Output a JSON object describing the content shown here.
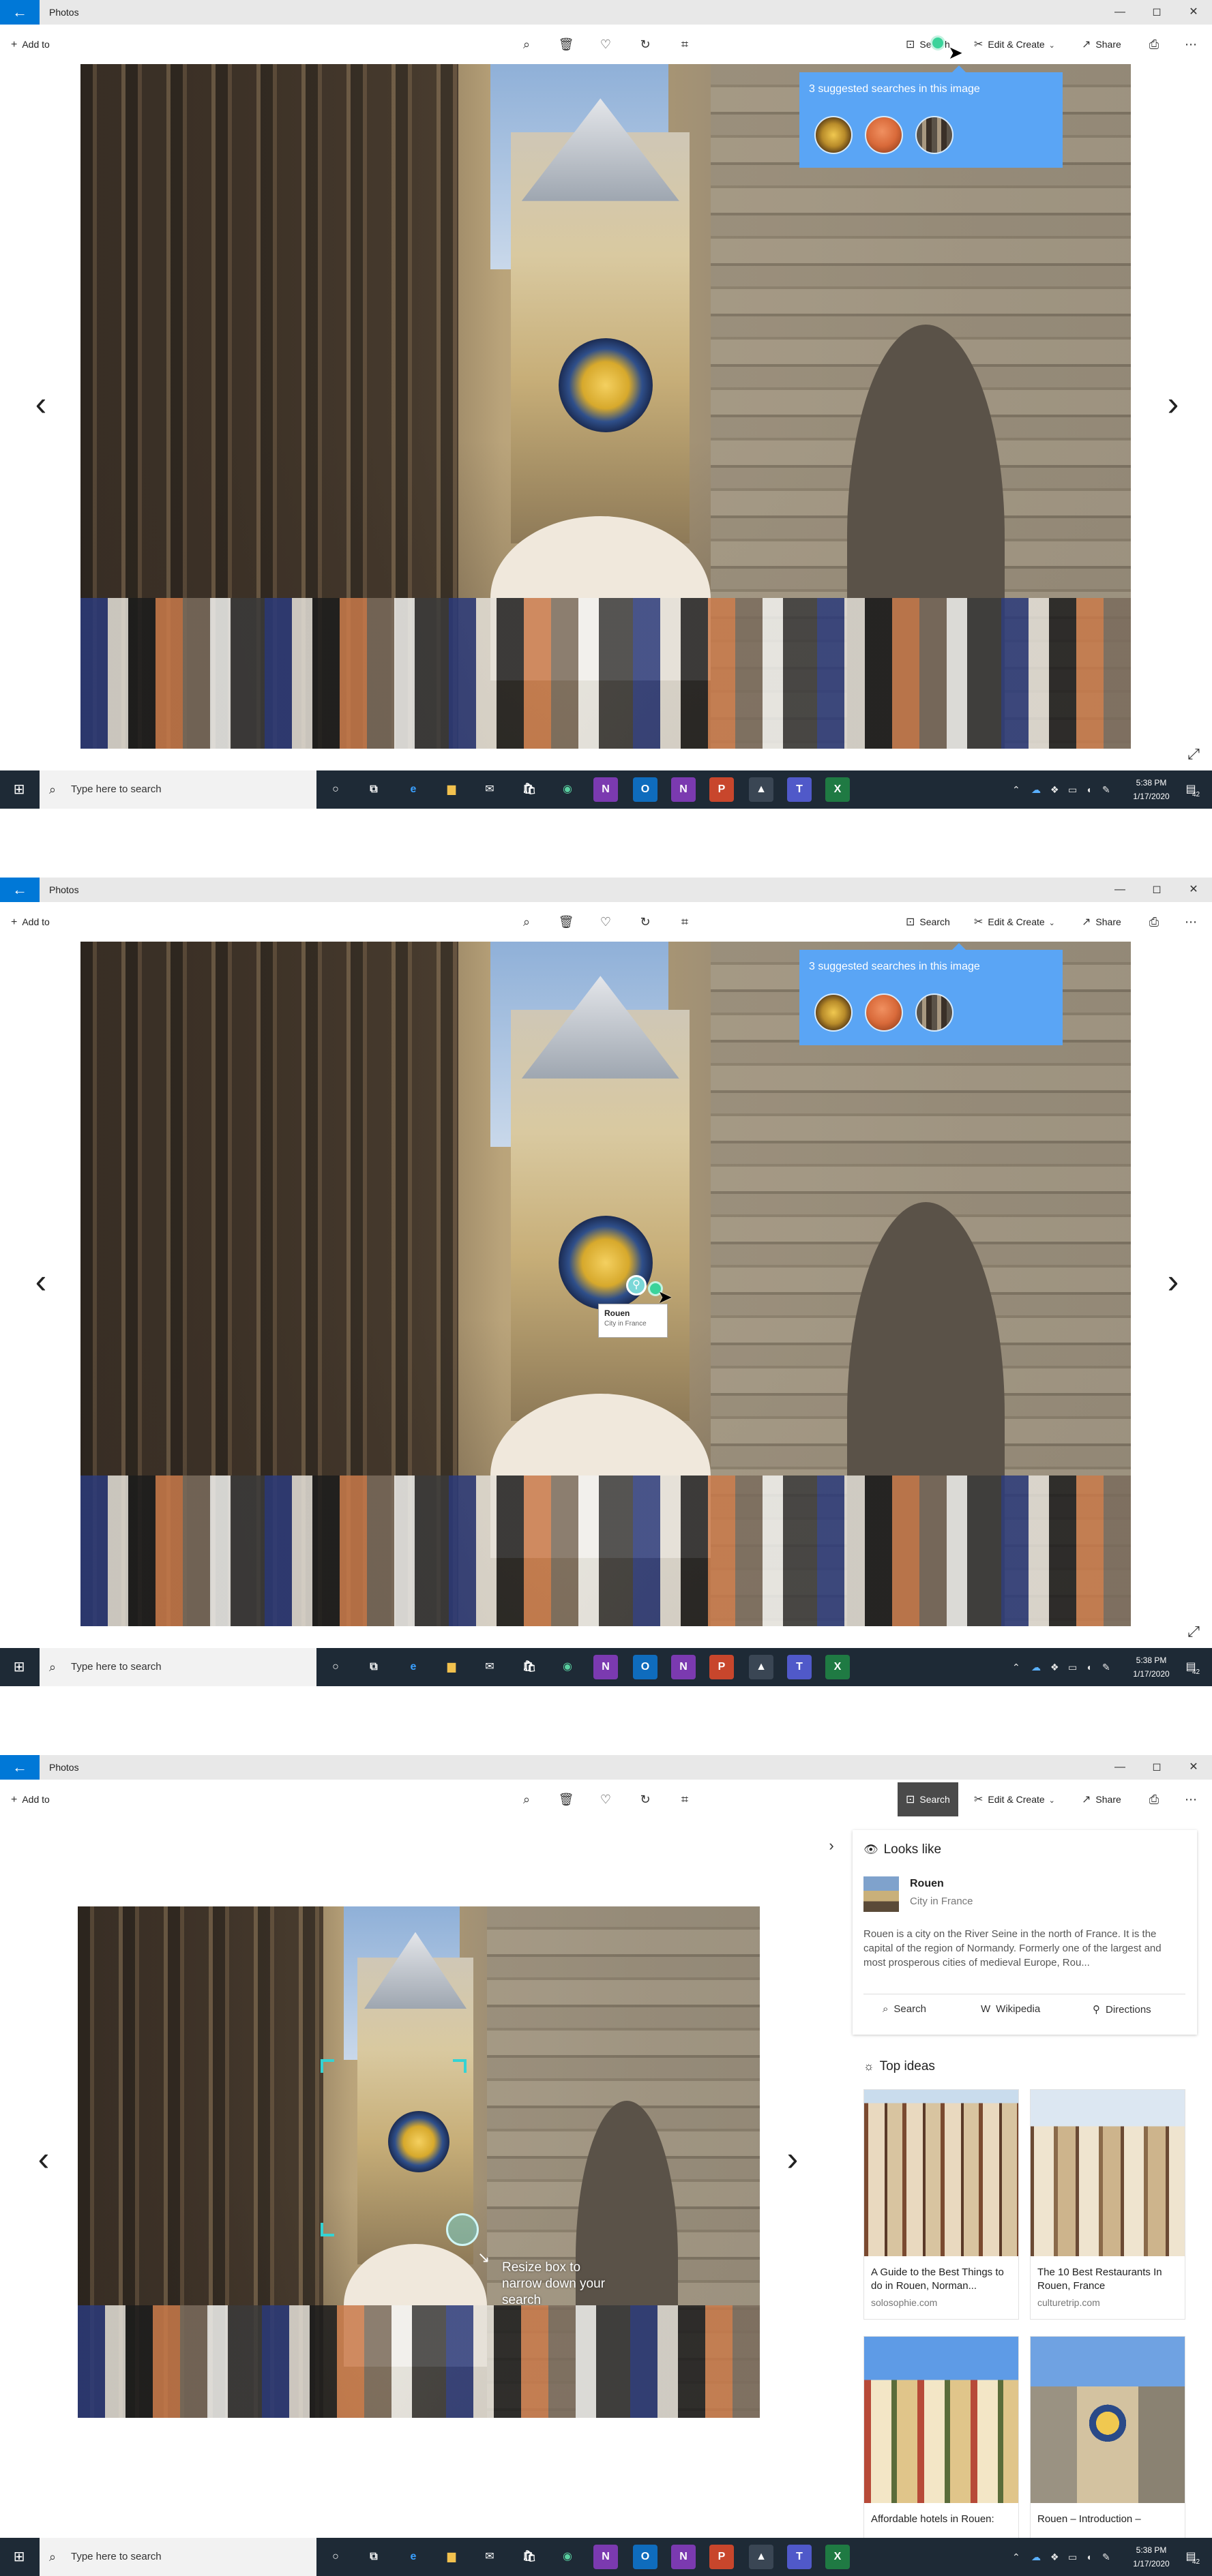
{
  "app": {
    "title": "Photos",
    "back_glyph": "←",
    "window_controls": {
      "minimize": "—",
      "maximize": "◻",
      "close": "✕"
    }
  },
  "toolbar": {
    "add_label": "Add to",
    "search_label": "Search",
    "edit_label": "Edit & Create",
    "share_label": "Share",
    "icons": [
      "zoom-icon",
      "delete-icon",
      "favorite-icon",
      "rotate-icon",
      "crop-icon",
      "print-icon",
      "more-icon"
    ]
  },
  "suggestions": {
    "title": "3 suggested searches in this image",
    "items": [
      "clock",
      "hat",
      "building"
    ]
  },
  "tooltip": {
    "name": "Rouen",
    "subtitle": "City in France"
  },
  "nav": {
    "prev": "‹",
    "next": "›",
    "expand": "⤢"
  },
  "taskbar": {
    "search_placeholder": "Type here to search",
    "time": "5:38 PM",
    "date": "1/17/2020",
    "notification_count": "42",
    "apps": [
      "cortana",
      "task-view",
      "edge",
      "file-explorer",
      "mail",
      "store",
      "chrome",
      "onenote",
      "outlook",
      "onenote-2",
      "powerpoint",
      "photos",
      "teams",
      "excel"
    ]
  },
  "visual_search": {
    "hint": "Resize box to narrow down your search",
    "looks_like": {
      "heading": "Looks like",
      "name": "Rouen",
      "subtitle": "City in France",
      "description": "Rouen is a city on the River Seine in the north of France. It is the capital of the region of Normandy. Formerly one of the largest and most prosperous cities of medieval Europe, Rou...",
      "actions": [
        "Search",
        "Wikipedia",
        "Directions"
      ]
    },
    "top_ideas": {
      "heading": "Top ideas",
      "items": [
        {
          "title": "A Guide to the Best Things to do in Rouen, Norman...",
          "source": "solosophie.com"
        },
        {
          "title": "The 10 Best Restaurants In Rouen, France",
          "source": "culturetrip.com"
        },
        {
          "title": "Affordable hotels in Rouen:",
          "source": ""
        },
        {
          "title": "Rouen – Introduction –",
          "source": ""
        }
      ]
    }
  }
}
